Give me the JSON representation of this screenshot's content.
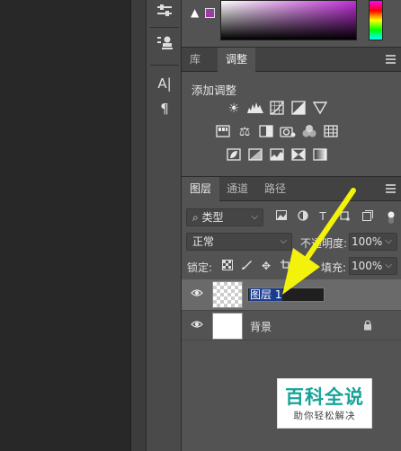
{
  "tool_strip": {
    "icons": [
      "adjust-sliders-icon",
      "clone-source-icon",
      "character-icon",
      "paragraph-icon"
    ],
    "character_glyph": "A|",
    "paragraph_glyph": "¶"
  },
  "color_panel": {
    "warning_glyph": "▲",
    "gamut_color": "#9a3d9e"
  },
  "adjust_tabs": [
    {
      "label": "库",
      "active": false
    },
    {
      "label": "调整",
      "active": true
    }
  ],
  "adjustments": {
    "title": "添加调整"
  },
  "layers_tabs": [
    {
      "label": "图层",
      "active": true
    },
    {
      "label": "通道",
      "active": false
    },
    {
      "label": "路径",
      "active": false
    }
  ],
  "layers": {
    "filter_kind": "类型",
    "blend_mode": "正常",
    "opacity_label": "不透明度:",
    "opacity_value": "100%",
    "lock_label": "锁定:",
    "fill_label": "填充:",
    "fill_value": "100%",
    "items": [
      {
        "name": "图层 1",
        "editing": true,
        "visible": true
      },
      {
        "name": "背景",
        "editing": false,
        "visible": true,
        "locked": true
      }
    ]
  },
  "watermark": {
    "title": "百科全说",
    "subtitle": "助你轻松解决"
  },
  "colors": {
    "panel_bg": "#535353",
    "tab_bg": "#424242",
    "arrow": "#f2f20a",
    "watermark_accent": "#17a398"
  }
}
